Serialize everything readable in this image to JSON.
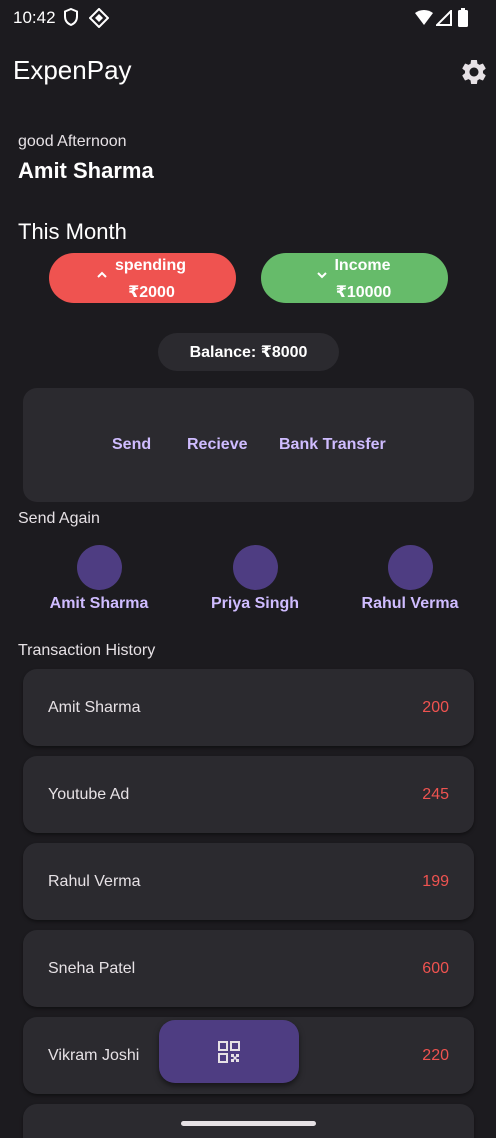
{
  "status_bar": {
    "time": "10:42",
    "icons": [
      "shield-icon",
      "sim-icon",
      "wifi-icon",
      "signal-icon",
      "battery-icon"
    ]
  },
  "app_bar": {
    "title": "ExpenPay",
    "settings_icon": "gear-icon"
  },
  "greeting": {
    "salutation": "good Afternoon",
    "name": "Amit Sharma"
  },
  "summary": {
    "period_title": "This Month",
    "spending": {
      "label": "spending",
      "amount": "₹2000",
      "color": "#ef5350",
      "icon": "chevron-up-icon"
    },
    "income": {
      "label": "Income",
      "amount": "₹10000",
      "color": "#66bb6a",
      "icon": "chevron-down-icon"
    },
    "balance": "Balance: ₹8000"
  },
  "actions": [
    "Send",
    "Recieve",
    "Bank Transfer"
  ],
  "send_again": {
    "title": "Send Again",
    "contacts": [
      "Amit Sharma",
      "Priya Singh",
      "Rahul Verma"
    ]
  },
  "transactions": {
    "title": "Transaction History",
    "items": [
      {
        "name": "Amit Sharma",
        "amount": "200"
      },
      {
        "name": "Youtube Ad",
        "amount": "245"
      },
      {
        "name": "Rahul Verma",
        "amount": "199"
      },
      {
        "name": "Sneha Patel",
        "amount": "600"
      },
      {
        "name": "Vikram Joshi",
        "amount": "220"
      }
    ]
  },
  "fab": {
    "icon": "qr-code-icon"
  },
  "colors": {
    "background": "#1c1b1f",
    "surface": "#2b2a2f",
    "accent": "#cfbcff",
    "primary_container": "#4e3d82",
    "expense": "#ef5350",
    "income": "#66bb6a"
  }
}
